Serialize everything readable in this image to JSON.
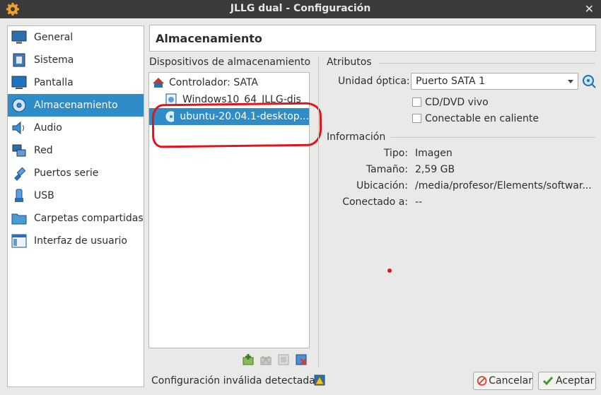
{
  "window": {
    "title": "JLLG dual - Configuración"
  },
  "sidebar": {
    "items": [
      {
        "label": "General",
        "icon": "monitor-icon"
      },
      {
        "label": "Sistema",
        "icon": "chip-icon"
      },
      {
        "label": "Pantalla",
        "icon": "display-icon"
      },
      {
        "label": "Almacenamiento",
        "icon": "disc-icon"
      },
      {
        "label": "Audio",
        "icon": "speaker-icon"
      },
      {
        "label": "Red",
        "icon": "network-icon"
      },
      {
        "label": "Puertos serie",
        "icon": "plug-icon"
      },
      {
        "label": "USB",
        "icon": "usb-icon"
      },
      {
        "label": "Carpetas compartidas",
        "icon": "folder-icon"
      },
      {
        "label": "Interfaz de usuario",
        "icon": "window-icon"
      }
    ],
    "selected": "Almacenamiento"
  },
  "header": {
    "title": "Almacenamiento"
  },
  "storage": {
    "title": "Dispositivos de almacenamiento",
    "controller": "Controlador: SATA",
    "devices": [
      {
        "label": "Windows10_64_JLLG-dis",
        "icon": "hard-disk-icon"
      },
      {
        "label": "ubuntu-20.04.1-desktop...",
        "icon": "optical-disc-icon",
        "selected": true
      }
    ]
  },
  "attributes": {
    "title": "Atributos",
    "optical_label": "Unidad óptica:",
    "optical_value": "Puerto SATA 1",
    "live_cd": "CD/DVD vivo",
    "hot_plug": "Conectable en caliente"
  },
  "info": {
    "title": "Información",
    "type_label": "Tipo:",
    "type_value": "Imagen",
    "size_label": "Tamaño:",
    "size_value": "2,59 GB",
    "location_label": "Ubicación:",
    "location_value": "/media/profesor/Elements/softwar...",
    "attached_label": "Conectado a:",
    "attached_value": "--"
  },
  "footer": {
    "status": "Configuración inválida detectada",
    "cancel": "Cancelar",
    "accept": "Aceptar"
  },
  "colors": {
    "selection": "#308cc6",
    "annotation": "#e0141c",
    "titlebar": "#3a3a38"
  }
}
